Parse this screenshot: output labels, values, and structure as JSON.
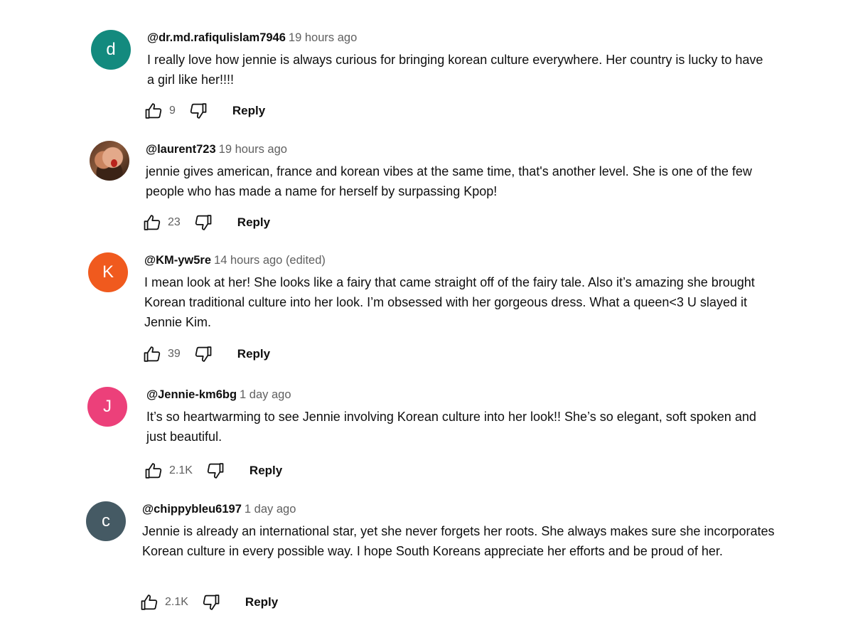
{
  "comments": [
    {
      "avatar_letter": "d",
      "avatar_color": "#138a7e",
      "author": "@dr.md.rafiqulislam7946",
      "time": "19 hours ago",
      "text": "I really love how jennie is always curious for bringing korean culture everywhere. Her country is lucky to have a girl like her!!!!",
      "likes": "9",
      "reply_label": "Reply"
    },
    {
      "avatar_letter": "",
      "avatar_color": "#5a3524",
      "author": "@laurent723",
      "time": "19 hours ago",
      "text": "jennie gives american, france and korean vibes at the same time, that's another level. She is one of the few people who has made a name for herself by surpassing Kpop!",
      "likes": "23",
      "reply_label": "Reply"
    },
    {
      "avatar_letter": "K",
      "avatar_color": "#f05a1e",
      "author": "@KM-yw5re",
      "time": "14 hours ago (edited)",
      "text": "I mean look at her! She looks like a fairy that came straight off of the fairy tale. Also it’s amazing she brought Korean traditional culture into her look. I’m obsessed with her gorgeous dress. What a queen<3 U slayed it Jennie Kim.",
      "likes": "39",
      "reply_label": "Reply"
    },
    {
      "avatar_letter": "J",
      "avatar_color": "#ec407a",
      "author": "@Jennie-km6bg",
      "time": "1 day ago",
      "text": "It’s so heartwarming to see Jennie involving Korean culture into her look!! She’s so elegant, soft spoken and just beautiful.",
      "likes": "2.1K",
      "reply_label": "Reply"
    },
    {
      "avatar_letter": "c",
      "avatar_color": "#455a64",
      "author": "@chippybleu6197",
      "time": "1 day ago",
      "text": "Jennie is already an international star, yet she never forgets her roots. She always makes sure she incorporates Korean culture in every possible way. I hope South Koreans appreciate her efforts and be proud of her.",
      "likes": "2.1K",
      "reply_label": "Reply"
    }
  ]
}
